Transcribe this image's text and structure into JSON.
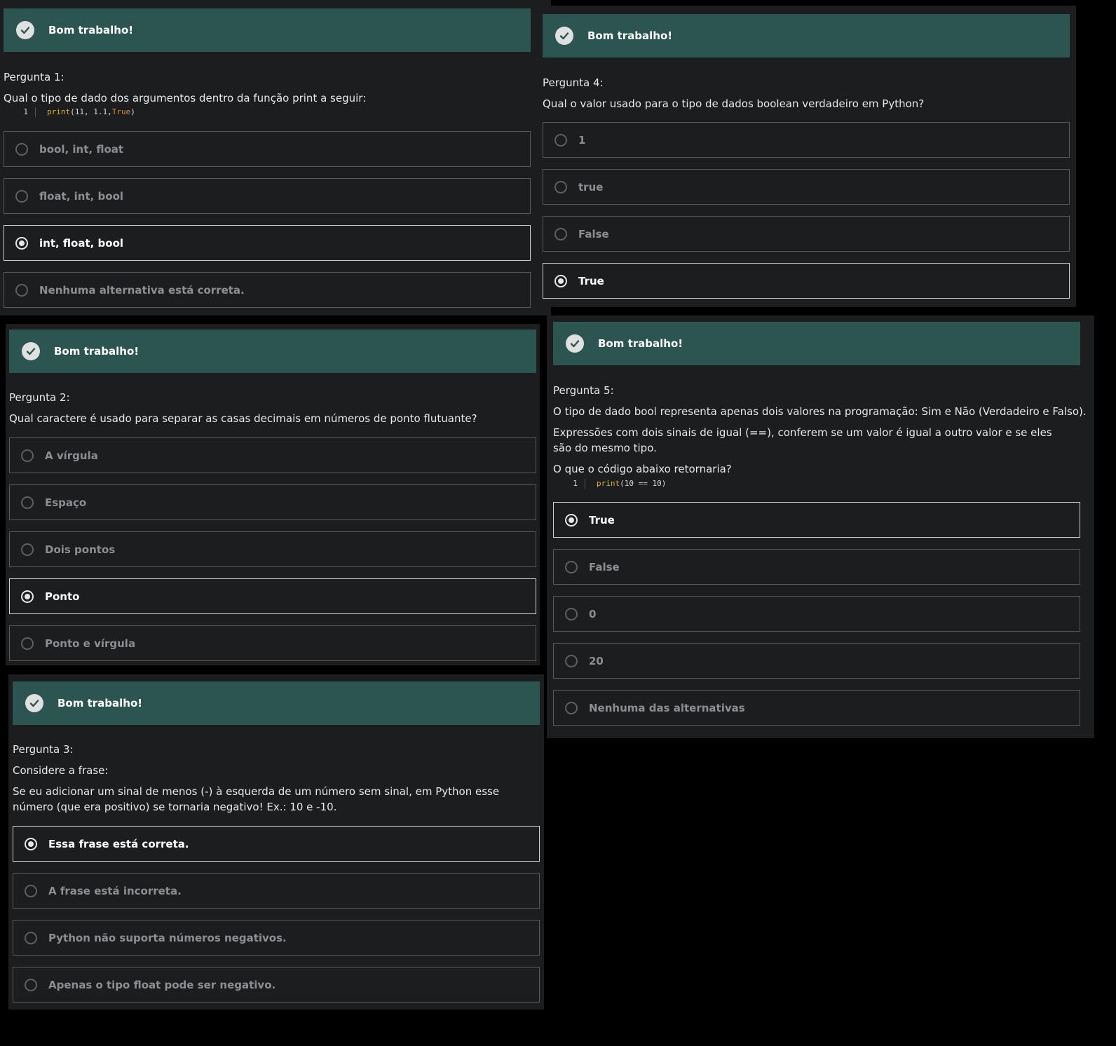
{
  "banner_text": "Bom trabalho!",
  "q1": {
    "title": "Pergunta 1:",
    "text": "Qual o tipo de dado dos argumentos dentro da função print a seguir:",
    "code": {
      "line": "1",
      "fn": "print",
      "args": "(11, 1.1, ",
      "kw": "True",
      "close": ")"
    },
    "options": [
      "bool, int, float",
      "float, int, bool",
      "int, float, bool",
      "Nenhuma alternativa está correta."
    ],
    "selected": 2
  },
  "q4": {
    "title": "Pergunta 4:",
    "text": "Qual o valor usado para o tipo de dados boolean verdadeiro em Python?",
    "options": [
      "1",
      "true",
      "False",
      "True"
    ],
    "selected": 3
  },
  "q2": {
    "title": "Pergunta 2:",
    "text": "Qual caractere é usado para separar as casas decimais em números de ponto flutuante?",
    "options": [
      "A vírgula",
      "Espaço",
      "Dois pontos",
      "Ponto",
      "Ponto e vírgula"
    ],
    "selected": 3
  },
  "q5": {
    "title": "Pergunta 5:",
    "text1": "O tipo de dado bool representa apenas dois valores na programação: Sim e Não (Verdadeiro e Falso).",
    "text2": "Expressões com dois sinais de igual (==), conferem se um valor é igual a outro valor e se eles são do mesmo tipo.",
    "text3": "O que o código abaixo retornaria?",
    "code": {
      "line": "1",
      "fn": "print",
      "args": "(10 == 10)"
    },
    "options": [
      "True",
      "False",
      "0",
      "20",
      "Nenhuma das alternativas"
    ],
    "selected": 0
  },
  "q3": {
    "title": "Pergunta 3:",
    "text1": "Considere a frase:",
    "text2": "Se eu adicionar um sinal de menos (-) à esquerda de um número sem sinal, em Python esse número (que era positivo) se tornaria negativo! Ex.: 10 e -10.",
    "options": [
      "Essa frase está correta.",
      "A frase está incorreta.",
      "Python não suporta números negativos.",
      "Apenas o tipo float pode ser negativo."
    ],
    "selected": 0
  }
}
